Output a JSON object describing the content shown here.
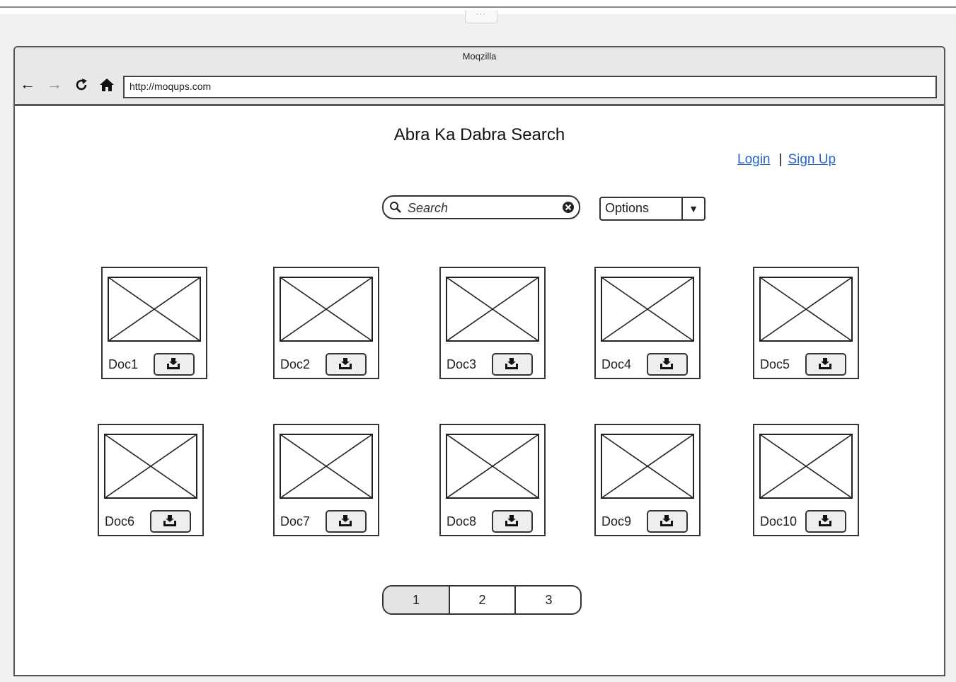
{
  "browser": {
    "title": "Moqzilla",
    "url": "http://moqups.com",
    "nav": [
      "back-icon",
      "forward-icon",
      "refresh-icon",
      "home-icon"
    ]
  },
  "page": {
    "title": "Abra Ka Dabra Search",
    "auth": {
      "login": "Login",
      "separator": "|",
      "signup": "Sign Up"
    },
    "search": {
      "placeholder": "Search",
      "value": ""
    },
    "options": {
      "selected": "Options"
    },
    "docs": [
      "Doc1",
      "Doc2",
      "Doc3",
      "Doc4",
      "Doc5",
      "Doc6",
      "Doc7",
      "Doc8",
      "Doc9",
      "Doc10"
    ],
    "pagination": {
      "pages": [
        "1",
        "2",
        "3"
      ],
      "current": "1"
    }
  },
  "icons": {
    "search": "search-icon",
    "clear": "clear-icon",
    "dropdown": "chevron-down-icon",
    "download": "download-icon",
    "thumbnail": "image-placeholder-icon"
  }
}
